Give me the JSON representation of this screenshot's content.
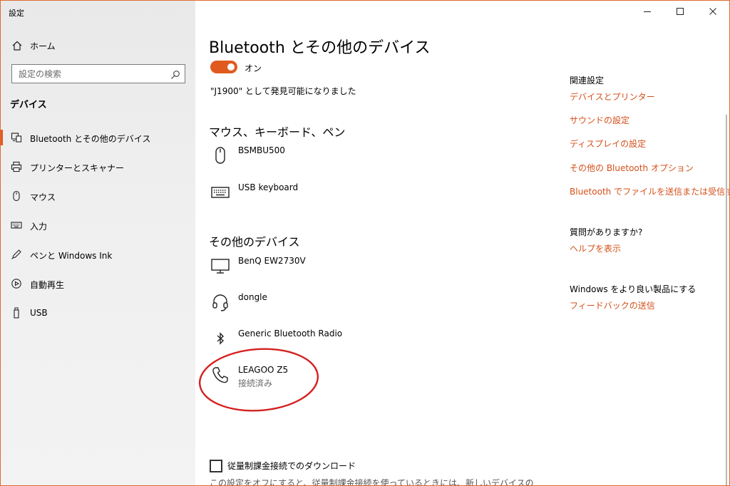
{
  "window": {
    "app_title": "設定",
    "minimize_label": "",
    "maximize_label": "",
    "close_label": ""
  },
  "sidebar": {
    "home_label": "ホーム",
    "search_placeholder": "設定の検索",
    "section_heading": "デバイス",
    "items": [
      {
        "label": "Bluetooth とその他のデバイス",
        "icon": "bluetooth-devices-icon",
        "selected": true
      },
      {
        "label": "プリンターとスキャナー",
        "icon": "printer-icon",
        "selected": false
      },
      {
        "label": "マウス",
        "icon": "mouse-icon",
        "selected": false
      },
      {
        "label": "入力",
        "icon": "keyboard-icon",
        "selected": false
      },
      {
        "label": "ペンと Windows Ink",
        "icon": "pen-icon",
        "selected": false
      },
      {
        "label": "自動再生",
        "icon": "autoplay-icon",
        "selected": false
      },
      {
        "label": "USB",
        "icon": "usb-icon",
        "selected": false
      }
    ]
  },
  "main": {
    "title": "Bluetooth とその他のデバイス",
    "bluetooth_toggle": {
      "state_label": "オン",
      "on": true
    },
    "discoverable_text": "\"J1900\" として発見可能になりました",
    "groups": [
      {
        "heading": "マウス、キーボード、ペン",
        "devices": [
          {
            "name": "BSMBU500",
            "status": "",
            "icon": "mouse-icon"
          },
          {
            "name": "USB keyboard",
            "status": "",
            "icon": "keyboard-icon"
          }
        ]
      },
      {
        "heading": "その他のデバイス",
        "devices": [
          {
            "name": "BenQ EW2730V",
            "status": "",
            "icon": "monitor-icon"
          },
          {
            "name": "dongle",
            "status": "",
            "icon": "headset-icon"
          },
          {
            "name": "Generic Bluetooth Radio",
            "status": "",
            "icon": "bluetooth-icon"
          },
          {
            "name": "LEAGOO Z5",
            "status": "接続済み",
            "icon": "phone-icon"
          }
        ]
      }
    ],
    "metered": {
      "checkbox_label": "従量制課金接続でのダウンロード",
      "checked": false,
      "description": "この設定をオフにすると、従量制課金接続を使っているときには、新しいデバイスの"
    }
  },
  "right": {
    "related_heading": "関連設定",
    "related_links": [
      "デバイスとプリンター",
      "サウンドの設定",
      "ディスプレイの設定",
      "その他の Bluetooth オプション",
      "Bluetooth でファイルを送信または受信する"
    ],
    "question_heading": "質問がありますか?",
    "help_link": "ヘルプを表示",
    "improve_heading": "Windows をより良い製品にする",
    "feedback_link": "フィードバックの送信"
  },
  "colors": {
    "accent": "#e05a1f",
    "link": "#d4501a",
    "annotation": "#d42020",
    "sidebar_bg": "#eeeeee"
  }
}
